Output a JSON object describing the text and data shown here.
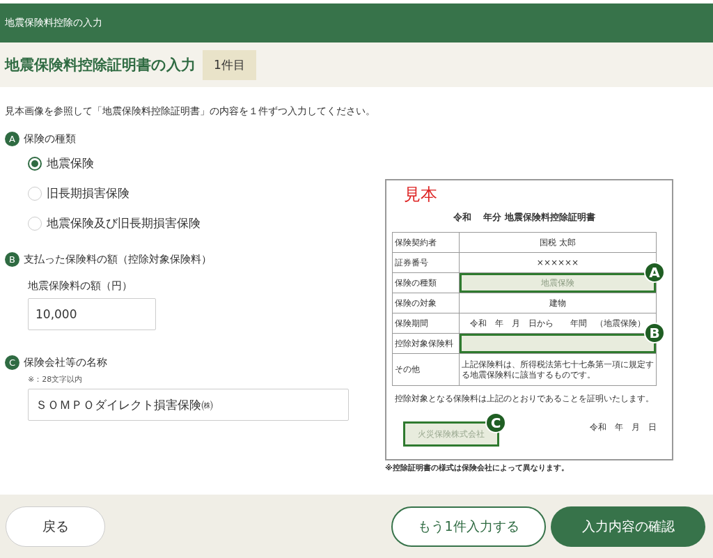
{
  "header": {
    "title": "地震保険料控除の入力"
  },
  "page_title": {
    "title": "地震保険料控除証明書の入力",
    "counter": "1件目"
  },
  "instruction": "見本画像を参照して「地震保険料控除証明書」の内容を１件ずつ入力してください。",
  "sections": [
    {
      "marker": "A",
      "kind": "radio",
      "label": "保険の種類",
      "options": [
        {
          "label": "地震保険",
          "selected": true
        },
        {
          "label": "旧長期損害保険",
          "selected": false
        },
        {
          "label": "地震保険及び旧長期損害保険",
          "selected": false
        }
      ]
    },
    {
      "marker": "B",
      "kind": "amount",
      "label": "支払った保険料の額（控除対象保険料）",
      "field_label": "地震保険料の額（円）",
      "value": "10,000"
    },
    {
      "marker": "C",
      "kind": "text",
      "label": "保険会社等の名称",
      "note": "※：28文字以内",
      "value": "ＳＯＭＰＯダイレクト損害保険㈱"
    }
  ],
  "sample": {
    "stamp": "見本",
    "title": "令和　 年分  地震保険料控除証明書",
    "rows": [
      {
        "label": "保険契約者",
        "value": "国税  太郎",
        "highlighted": false
      },
      {
        "label": "証券番号",
        "value": "××××××",
        "highlighted": false
      },
      {
        "label": "保険の種類",
        "value": "地震保険",
        "highlighted": true,
        "marker": "A"
      },
      {
        "label": "保険の対象",
        "value": "建物",
        "highlighted": false
      },
      {
        "label": "保険期間",
        "value": "令和　年　月　日から　　年間　（地震保険）",
        "highlighted": false
      },
      {
        "label": "控除対象保険料",
        "highlighted": true,
        "marker": "B"
      },
      {
        "label": "その他",
        "value": "上記保険料は、所得税法第七十七条第一項に規定する地震保険料に該当するものです。",
        "highlighted": false,
        "kind": "long"
      }
    ],
    "statement": "控除対象となる保険料は上記のとおりであることを証明いたします。",
    "company": "火災保険株式会社",
    "company_marker": "C",
    "date": "令和　年　月　日",
    "note": "※控除証明書の様式は保険会社によって異なります。"
  },
  "footer": {
    "back": "戻る",
    "add_another": "もう1件入力する",
    "confirm": "入力内容の確認"
  }
}
